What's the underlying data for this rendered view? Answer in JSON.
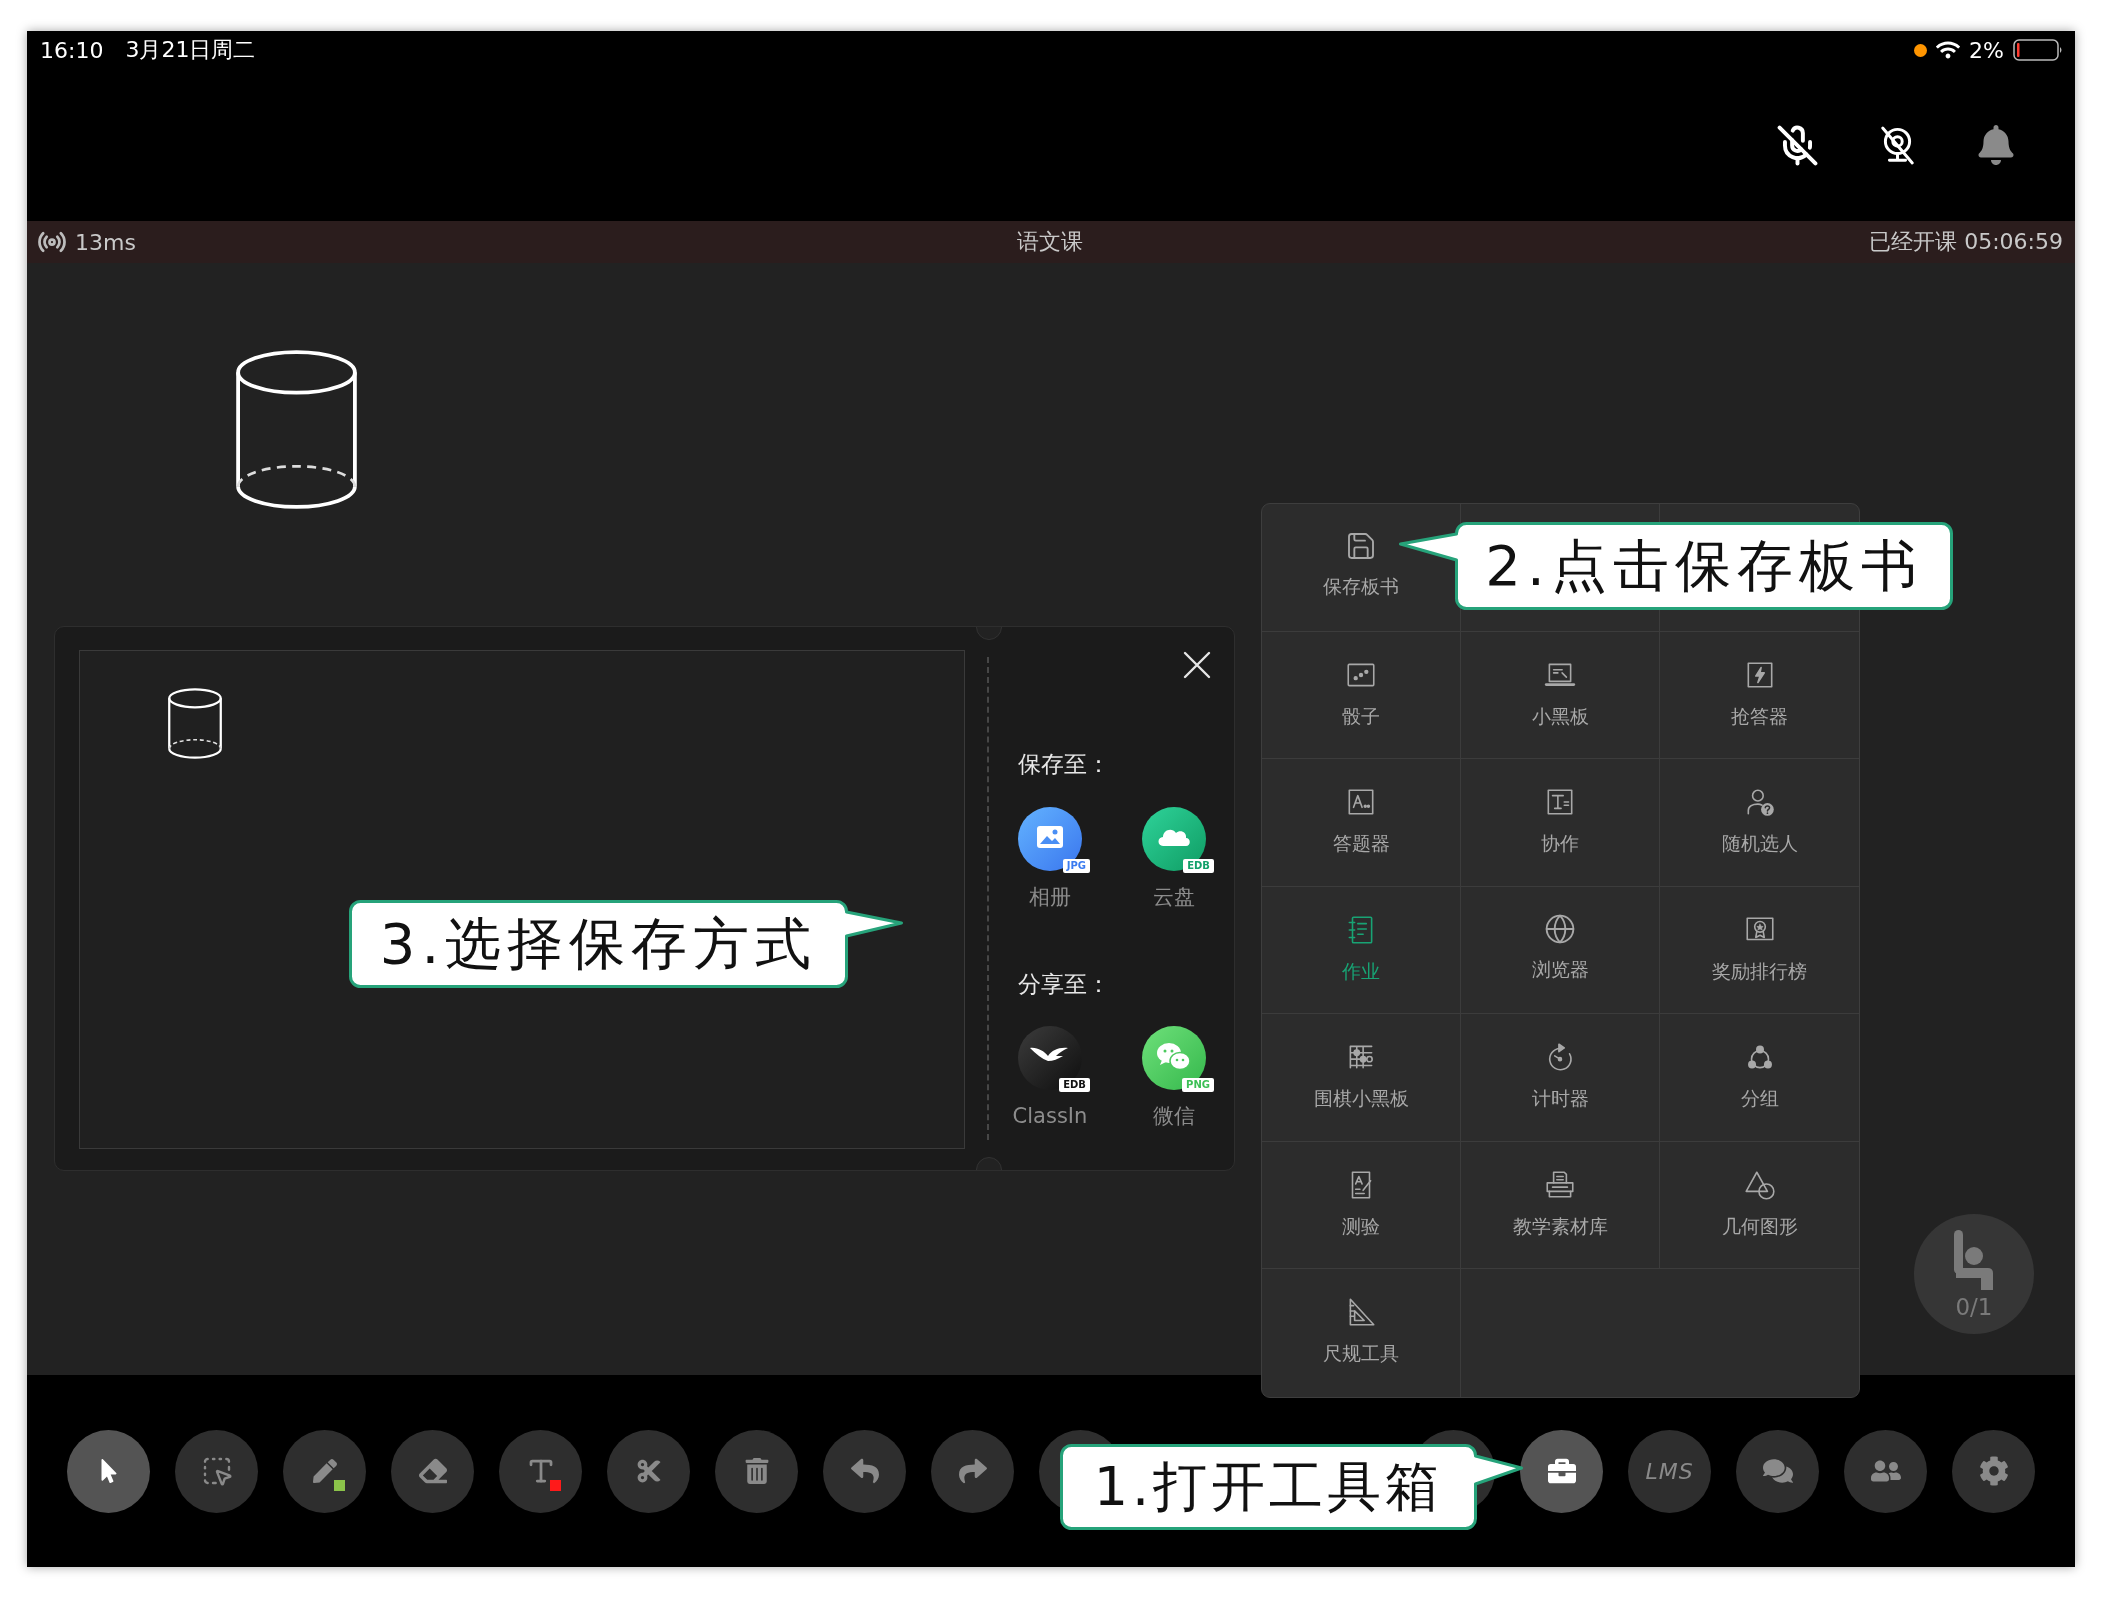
{
  "status_bar": {
    "time": "16:10",
    "date": "3月21日周二",
    "battery": "2%"
  },
  "controls": {
    "microphone_on": false,
    "camera_on": false
  },
  "class_bar": {
    "latency": "13ms",
    "title": "语文课",
    "elapsed": "已经开课 05:06:59"
  },
  "save_dialog": {
    "save_title": "保存至：",
    "save_targets": [
      {
        "label": "相册",
        "badge": "JPG"
      },
      {
        "label": "云盘",
        "badge": "EDB"
      }
    ],
    "share_title": "分享至：",
    "share_targets": [
      {
        "label": "ClassIn",
        "badge": "EDB"
      },
      {
        "label": "微信",
        "badge": "PNG"
      }
    ]
  },
  "toolbox": {
    "rows": [
      {
        "items": [
          {
            "label": "保存板书",
            "active": false
          }
        ]
      },
      {
        "items": [
          {
            "label": "骰子",
            "active": false
          },
          {
            "label": "小黑板",
            "active": false
          },
          {
            "label": "抢答器",
            "active": false
          }
        ]
      },
      {
        "items": [
          {
            "label": "答题器",
            "active": false
          },
          {
            "label": "协作",
            "active": false
          },
          {
            "label": "随机选人",
            "active": false
          }
        ]
      },
      {
        "items": [
          {
            "label": "作业",
            "active": true
          },
          {
            "label": "浏览器",
            "active": false
          },
          {
            "label": "奖励排行榜",
            "active": false
          }
        ]
      },
      {
        "items": [
          {
            "label": "围棋小黑板",
            "active": false
          },
          {
            "label": "计时器",
            "active": false
          },
          {
            "label": "分组",
            "active": false
          }
        ]
      },
      {
        "items": [
          {
            "label": "测验",
            "active": false
          },
          {
            "label": "教学素材库",
            "active": false
          },
          {
            "label": "几何图形",
            "active": false
          }
        ]
      },
      {
        "items": [
          {
            "label": "尺规工具",
            "active": false
          }
        ]
      }
    ]
  },
  "raise_hand": {
    "count": "0/1"
  },
  "toolbar": {
    "left_buttons": [
      {
        "selected": true
      },
      {
        "selected": false
      },
      {
        "selected": false,
        "color": "#8bc34a"
      },
      {
        "selected": false
      },
      {
        "selected": false,
        "color": "#ff1a1a"
      },
      {
        "selected": false
      },
      {
        "selected": false
      },
      {
        "selected": false
      },
      {
        "selected": false
      },
      {
        "selected": false
      }
    ],
    "right_buttons": [
      {
        "selected": false
      },
      {
        "selected": true
      },
      {
        "selected": false,
        "label": "LMS"
      },
      {
        "selected": false
      },
      {
        "selected": false
      },
      {
        "selected": false
      }
    ]
  },
  "callouts": [
    {
      "text": "1.打开工具箱"
    },
    {
      "text": "2.点击保存板书"
    },
    {
      "text": "3.选择保存方式"
    }
  ]
}
